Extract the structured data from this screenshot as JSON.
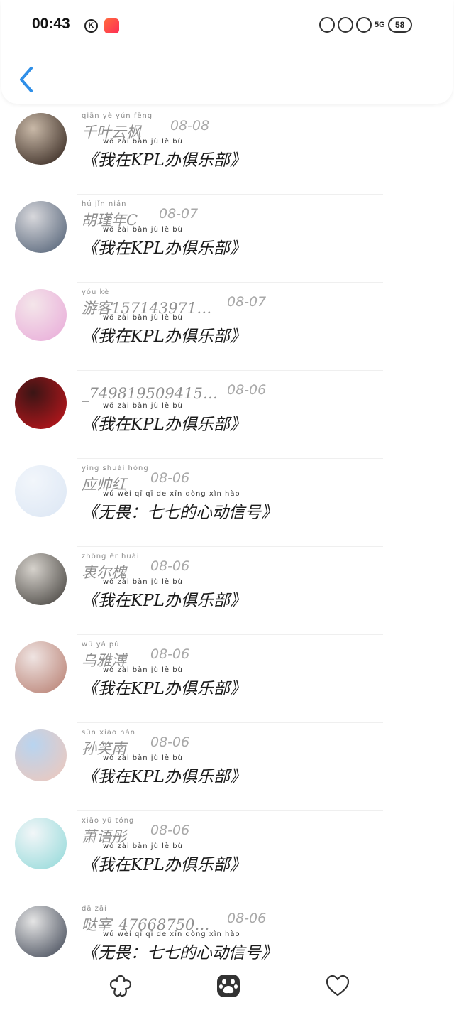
{
  "status_bar": {
    "time": "00:43",
    "k_label": "K",
    "network": "5G",
    "battery": "58"
  },
  "messages": [
    {
      "name_pinyin": "qiān yè yún fēng",
      "name": "千叶云枫",
      "date": "08-08",
      "content_pinyin": "wǒ zài bàn jù lè bù",
      "content": "《我在KPL办俱乐部》",
      "avatar_colors": [
        "#2b1d16",
        "#c9b9a8"
      ]
    },
    {
      "name_pinyin": "hú jǐn nián",
      "name": "胡瑾年C",
      "date": "08-07",
      "content_pinyin": "wǒ zài bàn jù lè bù",
      "content": "《我在KPL办俱乐部》",
      "avatar_colors": [
        "#4a5a70",
        "#d8d8dc"
      ]
    },
    {
      "name_pinyin": "yóu kè",
      "name": "游客157143971…",
      "date": "08-07",
      "content_pinyin": "wǒ zài bàn jù lè bù",
      "content": "《我在KPL办俱乐部》",
      "avatar_colors": [
        "#e8a8d8",
        "#f4e6ea"
      ]
    },
    {
      "name_pinyin": "",
      "name": "_749819509415…",
      "date": "08-06",
      "content_pinyin": "wǒ zài bàn jù lè bù",
      "content": "《我在KPL办俱乐部》",
      "avatar_colors": [
        "#c8161d",
        "#3a1515"
      ]
    },
    {
      "name_pinyin": "yìng shuài hóng",
      "name": "应帅红",
      "date": "08-06",
      "content_pinyin": "wú wèi qī qī de xīn dòng xìn hào",
      "content": "《无畏：七七的心动信号》",
      "avatar_colors": [
        "#dbe6f4",
        "#f2f6fb"
      ]
    },
    {
      "name_pinyin": "zhōng ěr huái",
      "name": "衷尔槐",
      "date": "08-06",
      "content_pinyin": "wǒ zài bàn jù lè bù",
      "content": "《我在KPL办俱乐部》",
      "avatar_colors": [
        "#3d3a36",
        "#d6d2cc"
      ]
    },
    {
      "name_pinyin": "wū yǎ pǔ",
      "name": "乌雅溥",
      "date": "08-06",
      "content_pinyin": "wǒ zài bàn jù lè bù",
      "content": "《我在KPL办俱乐部》",
      "avatar_colors": [
        "#b57a6c",
        "#efe4e2"
      ]
    },
    {
      "name_pinyin": "sūn xiào nán",
      "name": "孙笑南",
      "date": "08-06",
      "content_pinyin": "wǒ zài bàn jù lè bù",
      "content": "《我在KPL办俱乐部》",
      "avatar_colors": [
        "#f2c7b8",
        "#b8d4f0"
      ]
    },
    {
      "name_pinyin": "xiāo yǔ tóng",
      "name": "萧语彤",
      "date": "08-06",
      "content_pinyin": "wǒ zài bàn jù lè bù",
      "content": "《我在KPL办俱乐部》",
      "avatar_colors": [
        "#8fd8d8",
        "#f2f6f8"
      ]
    },
    {
      "name_pinyin": "dā zǎi",
      "name": "哒宰_47668750…",
      "date": "08-06",
      "content_pinyin": "wú wèi qī qī de xīn dòng xìn hào",
      "content": "《无畏：七七的心动信号》",
      "avatar_colors": [
        "#3a4150",
        "#e5e5e5"
      ]
    }
  ],
  "bottom_nav": [
    "flower-icon",
    "paw-icon",
    "heart-icon"
  ],
  "colors": {
    "accent": "#2f8fe8"
  }
}
